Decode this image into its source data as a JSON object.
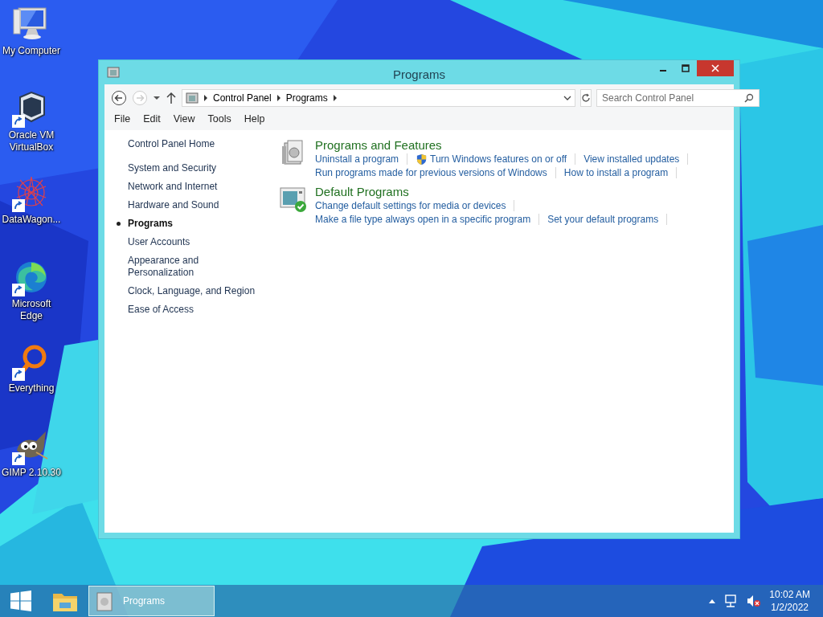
{
  "desktop_icons": [
    {
      "kind": "computer",
      "label": "My Computer",
      "shortcut": false
    },
    {
      "kind": "virtualbox",
      "label": "Oracle VM VirtualBox",
      "shortcut": true
    },
    {
      "kind": "datawagon",
      "label": "DataWagon...",
      "shortcut": true
    },
    {
      "kind": "edge",
      "label": "Microsoft Edge",
      "shortcut": true
    },
    {
      "kind": "everything",
      "label": "Everything",
      "shortcut": true
    },
    {
      "kind": "gimp",
      "label": "GIMP 2.10.30",
      "shortcut": true
    }
  ],
  "window": {
    "title": "Programs",
    "nav": {
      "back_disabled": false,
      "forward_disabled": true
    },
    "address": {
      "crumbs": [
        "Control Panel",
        "Programs"
      ]
    },
    "search": {
      "placeholder": "Search Control Panel"
    },
    "menu": [
      "File",
      "Edit",
      "View",
      "Tools",
      "Help"
    ],
    "sidebar": {
      "home": "Control Panel Home",
      "items": [
        {
          "label": "System and Security",
          "selected": false
        },
        {
          "label": "Network and Internet",
          "selected": false
        },
        {
          "label": "Hardware and Sound",
          "selected": false
        },
        {
          "label": "Programs",
          "selected": true
        },
        {
          "label": "User Accounts",
          "selected": false
        },
        {
          "label": "Appearance and Personalization",
          "selected": false
        },
        {
          "label": "Clock, Language, and Region",
          "selected": false
        },
        {
          "label": "Ease of Access",
          "selected": false
        }
      ]
    },
    "categories": [
      {
        "kind": "programs",
        "title": "Programs and Features",
        "link_rows": [
          [
            {
              "text": "Uninstall a program",
              "shield": false
            },
            {
              "text": "Turn Windows features on or off",
              "shield": true
            },
            {
              "text": "View installed updates",
              "shield": false
            }
          ],
          [
            {
              "text": "Run programs made for previous versions of Windows",
              "shield": false
            },
            {
              "text": "How to install a program",
              "shield": false
            }
          ]
        ]
      },
      {
        "kind": "defaults",
        "title": "Default Programs",
        "link_rows": [
          [
            {
              "text": "Change default settings for media or devices",
              "shield": false
            }
          ],
          [
            {
              "text": "Make a file type always open in a specific program",
              "shield": false
            },
            {
              "text": "Set your default programs",
              "shield": false
            }
          ]
        ]
      }
    ]
  },
  "taskbar": {
    "buttons": [
      {
        "label": "Programs",
        "selected": true
      }
    ],
    "time": "10:02 AM",
    "date": "1/2/2022"
  }
}
